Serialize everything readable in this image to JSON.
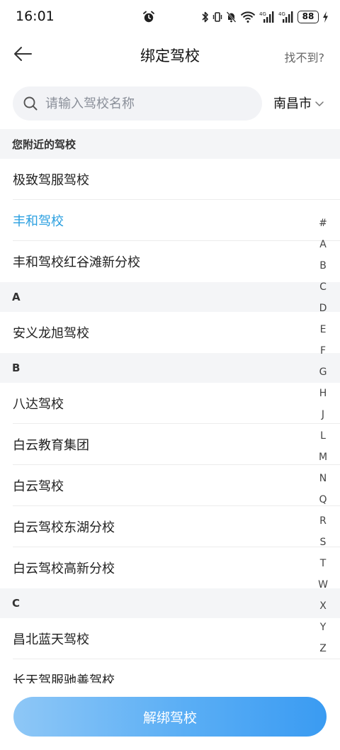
{
  "status": {
    "time": "16:01",
    "network_label": "4G",
    "battery": "88"
  },
  "nav": {
    "title": "绑定驾校",
    "right_label": "找不到?"
  },
  "search": {
    "placeholder": "请输入驾校名称",
    "value": ""
  },
  "city": {
    "label": "南昌市"
  },
  "sections": [
    {
      "title": "您附近的驾校",
      "items": [
        {
          "name": "极致驾服驾校",
          "selected": false
        },
        {
          "name": "丰和驾校",
          "selected": true
        },
        {
          "name": "丰和驾校红谷滩新分校",
          "selected": false
        }
      ]
    },
    {
      "title": "A",
      "items": [
        {
          "name": "安义龙旭驾校",
          "selected": false
        }
      ]
    },
    {
      "title": "B",
      "items": [
        {
          "name": "八达驾校",
          "selected": false
        },
        {
          "name": "白云教育集团",
          "selected": false
        },
        {
          "name": "白云驾校",
          "selected": false
        },
        {
          "name": "白云驾校东湖分校",
          "selected": false
        },
        {
          "name": "白云驾校高新分校",
          "selected": false
        }
      ]
    },
    {
      "title": "C",
      "items": [
        {
          "name": "昌北蓝天驾校",
          "selected": false
        },
        {
          "name": "长天驾服驰善驾校",
          "selected": false
        }
      ]
    }
  ],
  "index_letters": [
    "#",
    "A",
    "B",
    "C",
    "D",
    "E",
    "F",
    "G",
    "H",
    "J",
    "L",
    "M",
    "N",
    "Q",
    "R",
    "S",
    "T",
    "W",
    "X",
    "Y",
    "Z"
  ],
  "bottom": {
    "unbind_label": "解绑驾校"
  },
  "colors": {
    "accent": "#2a9fe0",
    "button_gradient_start": "#8ec7f6",
    "button_gradient_end": "#3a9bf2",
    "section_bg": "#f4f5f7"
  }
}
